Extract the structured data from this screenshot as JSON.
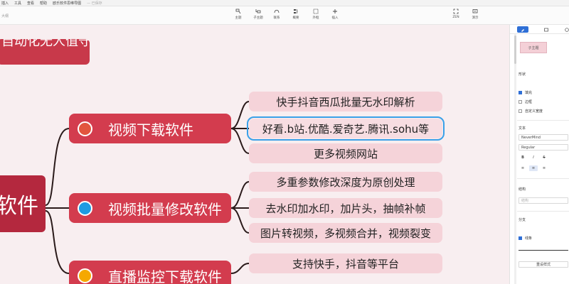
{
  "menubar": {
    "items": [
      "插入",
      "工具",
      "查看",
      "帮助"
    ],
    "app_title": "欧乐软件思维导图",
    "status": "已保存"
  },
  "toolbar": {
    "small_title": "大纲",
    "buttons": [
      {
        "label": "主题",
        "icon": "topic-icon"
      },
      {
        "label": "子主题",
        "icon": "subtopic-icon"
      },
      {
        "label": "联系",
        "icon": "relationship-icon"
      },
      {
        "label": "概要",
        "icon": "summary-icon"
      },
      {
        "label": "外框",
        "icon": "boundary-icon"
      },
      {
        "label": "插入",
        "icon": "plus-icon"
      }
    ],
    "right_buttons": [
      {
        "label": "ZEN",
        "icon": "zen-icon"
      },
      {
        "label": "演示",
        "icon": "present-icon"
      }
    ]
  },
  "mindmap": {
    "top_topic": "自动化无人值守",
    "central_topic": "软件",
    "branches": [
      {
        "label": "视频下载软件",
        "dot_color": "#e2553e",
        "leaves": [
          "快手抖音西瓜批量无水印解析",
          "好看.b站.优酷.爱奇艺.腾讯.sohu等",
          "更多视频网站"
        ],
        "selected_leaf": 1
      },
      {
        "label": "视频批量修改软件",
        "dot_color": "#1e9be3",
        "leaves": [
          "多重参数修改深度为原创处理",
          "去水印加水印，加片头，抽帧补帧",
          "图片转视频，多视频合并，视频裂变"
        ]
      },
      {
        "label": "直播监控下载软件",
        "dot_color": "#f5a800",
        "leaves": [
          "支持快手，抖音等平台"
        ]
      }
    ]
  },
  "panel": {
    "tabs": [
      "style-tab",
      "map-tab",
      "icon-tab"
    ],
    "style_preview": "子主题",
    "shape_heading": "形状",
    "fill_label": "填充",
    "fill_checked": true,
    "border_label": "边框",
    "border_checked": false,
    "custom_width_label": "自定义宽度",
    "custom_width_checked": false,
    "text_heading": "文本",
    "font_family": "NeverMind",
    "font_weight": "Regular",
    "format_buttons": [
      "B",
      "I",
      "S"
    ],
    "align_buttons": [
      "≡",
      "≡",
      "≡"
    ],
    "structure_heading": "结构",
    "structure_value": "结构",
    "branch_heading": "分支",
    "line_label": "线条",
    "line_checked": true,
    "reset_button": "重设样式"
  }
}
